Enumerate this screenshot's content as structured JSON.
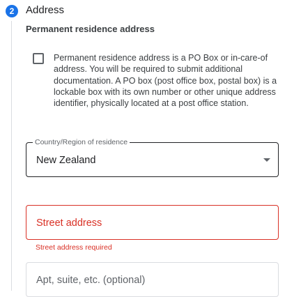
{
  "step": {
    "number": "2",
    "title": "Address"
  },
  "section": {
    "title": "Permanent residence address"
  },
  "po_box": {
    "checked": false,
    "label": "Permanent residence address is a PO Box or in-care-of address. You will be required to submit additional documentation. A PO box (post office box, postal box) is a lockable box with its own number or other unique address identifier, physically located at a post office station."
  },
  "country": {
    "label": "Country/Region of residence",
    "value": "New Zealand"
  },
  "street": {
    "placeholder": "Street address",
    "error": "Street address required"
  },
  "apt": {
    "placeholder": "Apt, suite, etc. (optional)"
  },
  "colors": {
    "accent": "#1a73e8",
    "error": "#d93025"
  }
}
